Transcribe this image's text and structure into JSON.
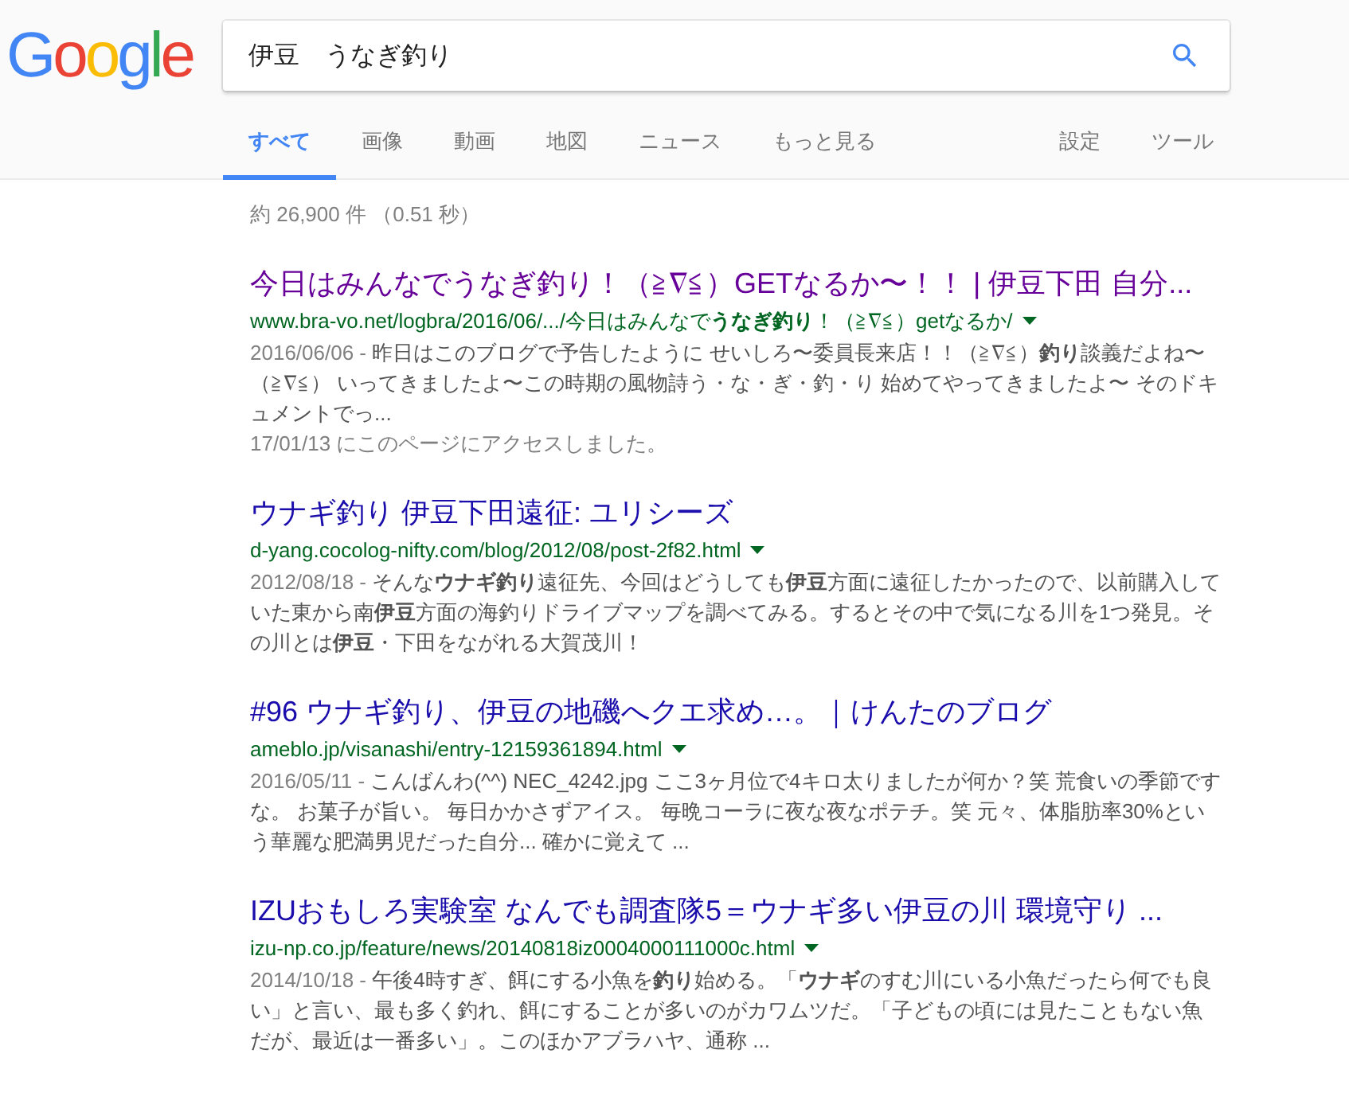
{
  "logo": "Google",
  "search": {
    "value": "伊豆　うなぎ釣り"
  },
  "tabs": [
    {
      "label": "すべて",
      "selected": true
    },
    {
      "label": "画像",
      "selected": false
    },
    {
      "label": "動画",
      "selected": false
    },
    {
      "label": "地図",
      "selected": false
    },
    {
      "label": "ニュース",
      "selected": false
    },
    {
      "label": "もっと見る",
      "selected": false
    }
  ],
  "tools": [
    "設定",
    "ツール"
  ],
  "stats": "約 26,900 件 （0.51 秒）",
  "results": [
    {
      "title": "今日はみんなでうなぎ釣り！（≧∇≦）GETなるか〜！！ | 伊豆下田 自分...",
      "visited": true,
      "url": "www.bra-vo.net/logbra/2016/06/.../今日はみんなで**うなぎ釣り**！（≧∇≦）getなるか/",
      "date": "2016/06/06 -",
      "snippet": "昨日はこのブログで予告したように せいしろ〜委員長来店！！（≧∇≦）**釣り**談義だよね〜（≧∇≦） いってきましたよ〜この時期の風物詩う・な・ぎ・釣・り 始めてやってきましたよ〜 そのドキュメントでっ...",
      "note": "17/01/13 にこのページにアクセスしました。"
    },
    {
      "title": "ウナギ釣り 伊豆下田遠征: ユリシーズ",
      "visited": false,
      "url": "d-yang.cocolog-nifty.com/blog/2012/08/post-2f82.html",
      "date": "2012/08/18 -",
      "snippet": "そんな**ウナギ釣り**遠征先、今回はどうしても**伊豆**方面に遠征したかったので、以前購入していた東から南**伊豆**方面の海釣りドライブマップを調べてみる。するとその中で気になる川を1つ発見。その川とは**伊豆**・下田をながれる大賀茂川！"
    },
    {
      "title": "#96 ウナギ釣り、伊豆の地磯へクエ求め…。｜けんたのブログ",
      "visited": false,
      "url": "ameblo.jp/visanashi/entry-12159361894.html",
      "date": "2016/05/11 -",
      "snippet": "こんばんわ(^^) NEC_4242.jpg ここ3ヶ月位で4キロ太りましたが何か？笑 荒食いの季節ですな。 お菓子が旨い。 毎日かかさずアイス。 毎晩コーラに夜な夜なポテチ。笑 元々、体脂肪率30%という華麗な肥満男児だった自分... 確かに覚えて ..."
    },
    {
      "title": "IZUおもしろ実験室 なんでも調査隊5＝ウナギ多い伊豆の川 環境守り ...",
      "visited": false,
      "url": "izu-np.co.jp/feature/news/20140818iz0004000111000c.html",
      "date": "2014/10/18 -",
      "snippet": "午後4時すぎ、餌にする小魚を**釣り**始める。「**ウナギ**のすむ川にいる小魚だったら何でも良い」と言い、最も多く釣れ、餌にすることが多いのがカワムツだ。「子どもの頃には見たこともない魚だが、最近は一番多い」。このほかアブラハヤ、通称 ..."
    }
  ]
}
